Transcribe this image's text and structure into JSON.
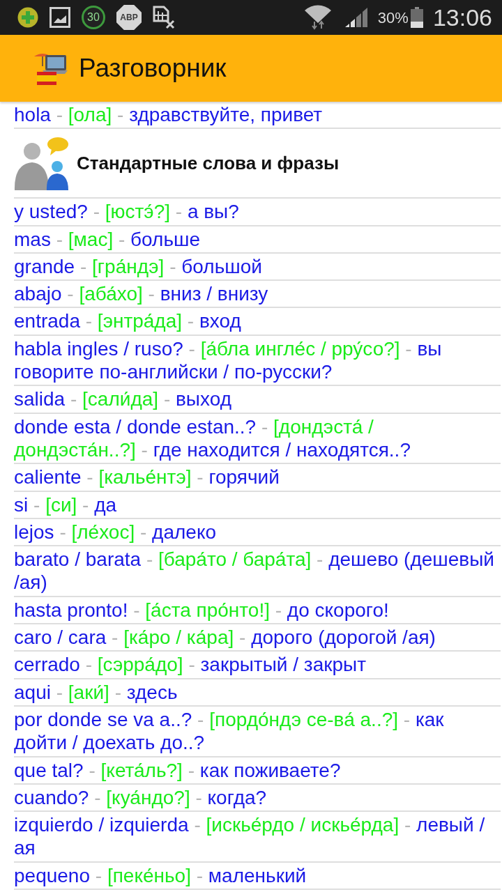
{
  "status_bar": {
    "notification_icons": [
      {
        "kind": "plus"
      },
      {
        "kind": "picture"
      },
      {
        "kind": "ring",
        "label": "30"
      },
      {
        "kind": "octagon",
        "label": "ABP"
      },
      {
        "kind": "document"
      }
    ],
    "battery": "30%",
    "time": "13:06"
  },
  "app_bar": {
    "title": "Разговорник"
  },
  "list": [
    {
      "kind": "phrase",
      "word": "hola",
      "dash_1": "-",
      "transcription": "[ола]",
      "dash_2": "-",
      "translation": "здравствуйте, привет"
    },
    {
      "kind": "section",
      "title": "Стандартные слова и фразы"
    },
    {
      "kind": "phrase",
      "word": "y usted?",
      "dash_1": "-",
      "transcription": "[юстэ́?]",
      "dash_2": "-",
      "translation": "а вы?"
    },
    {
      "kind": "phrase",
      "word": "mas",
      "dash_1": "-",
      "transcription": "[мас]",
      "dash_2": "-",
      "translation": "больше"
    },
    {
      "kind": "phrase",
      "word": "grande",
      "dash_1": "-",
      "transcription": "[гра́ндэ]",
      "dash_2": "-",
      "translation": "большой"
    },
    {
      "kind": "phrase",
      "word": "abajo",
      "dash_1": "-",
      "transcription": "[аба́хо]",
      "dash_2": "-",
      "translation": "вниз / внизу"
    },
    {
      "kind": "phrase",
      "word": "entrada",
      "dash_1": "-",
      "transcription": "[энтра́да]",
      "dash_2": "-",
      "translation": "вход"
    },
    {
      "kind": "phrase",
      "word": "habla ingles / ruso?",
      "dash_1": "-",
      "transcription": "[а́бла ингле́с / рру́со?]",
      "dash_2": "-",
      "translation": "вы говорите по-английски / по-русски?"
    },
    {
      "kind": "phrase",
      "word": "salida",
      "dash_1": "-",
      "transcription": "[сали́да]",
      "dash_2": "-",
      "translation": "выход"
    },
    {
      "kind": "phrase",
      "word": "donde esta / donde estan..?",
      "dash_1": "-",
      "transcription": "[дондэста́ / дондэста́н..?]",
      "dash_2": "-",
      "translation": "где находится / находятся..?"
    },
    {
      "kind": "phrase",
      "word": "caliente",
      "dash_1": "-",
      "transcription": "[калье́нтэ]",
      "dash_2": "-",
      "translation": "горячий"
    },
    {
      "kind": "phrase",
      "word": "si",
      "dash_1": "-",
      "transcription": "[си]",
      "dash_2": "-",
      "translation": "да"
    },
    {
      "kind": "phrase",
      "word": "lejos",
      "dash_1": "-",
      "transcription": "[ле́хос]",
      "dash_2": "-",
      "translation": "далеко"
    },
    {
      "kind": "phrase",
      "word": "barato / barata",
      "dash_1": "-",
      "transcription": "[бара́то / бара́та]",
      "dash_2": "-",
      "translation": "дешево (дешевый /ая)"
    },
    {
      "kind": "phrase",
      "word": "hasta pronto!",
      "dash_1": "-",
      "transcription": "[а́ста про́нто!]",
      "dash_2": "-",
      "translation": "до скорого!"
    },
    {
      "kind": "phrase",
      "word": "caro / cara",
      "dash_1": "-",
      "transcription": "[ка́ро / ка́ра]",
      "dash_2": "-",
      "translation": "дорого (дорогой /ая)"
    },
    {
      "kind": "phrase",
      "word": "cerrado",
      "dash_1": "-",
      "transcription": "[сэрра́до]",
      "dash_2": "-",
      "translation": "закрытый / закрыт"
    },
    {
      "kind": "phrase",
      "word": "aqui",
      "dash_1": "-",
      "transcription": "[аки́]",
      "dash_2": "-",
      "translation": "здесь"
    },
    {
      "kind": "phrase",
      "word": "por donde se va a..?",
      "dash_1": "-",
      "transcription": "[пордо́ндэ се-ва́ а..?]",
      "dash_2": "-",
      "translation": "как дойти / доехать до..?"
    },
    {
      "kind": "phrase",
      "word": "que tal?",
      "dash_1": "-",
      "transcription": "[кета́ль?]",
      "dash_2": "-",
      "translation": "как поживаете?"
    },
    {
      "kind": "phrase",
      "word": "cuando?",
      "dash_1": "-",
      "transcription": "[куа́ндо?]",
      "dash_2": "-",
      "translation": "когда?"
    },
    {
      "kind": "phrase",
      "word": "izquierdo / izquierda",
      "dash_1": "-",
      "transcription": "[искье́рдо / искье́рда]",
      "dash_2": "-",
      "translation": "левый / ая"
    },
    {
      "kind": "phrase",
      "word": "pequeno",
      "dash_1": "-",
      "transcription": "[пеке́ньо]",
      "dash_2": "-",
      "translation": "маленький"
    }
  ]
}
